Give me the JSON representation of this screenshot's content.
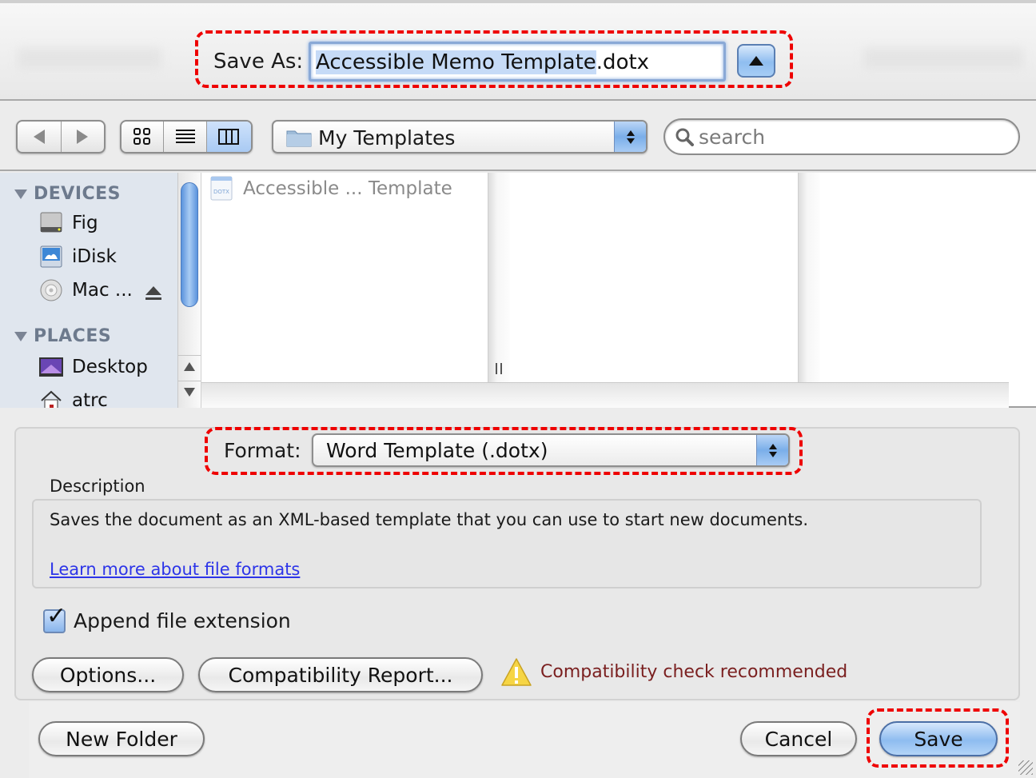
{
  "save_as": {
    "label": "Save As:",
    "filename_selected": "Accessible Memo Template",
    "filename_extension": ".dotx",
    "expand_button_icon": "triangle-up-icon"
  },
  "toolbar": {
    "back_icon": "back-arrow-icon",
    "forward_icon": "forward-arrow-icon",
    "view_modes": [
      {
        "name": "icon-view",
        "icon": "grid-icon",
        "active": false
      },
      {
        "name": "list-view",
        "icon": "list-icon",
        "active": false
      },
      {
        "name": "column-view",
        "icon": "columns-icon",
        "active": true
      }
    ],
    "location": "My Templates",
    "search_placeholder": "search"
  },
  "sidebar": {
    "sections": [
      {
        "title": "DEVICES",
        "items": [
          {
            "label": "Fig",
            "icon": "hard-drive-icon"
          },
          {
            "label": "iDisk",
            "icon": "idisk-icon"
          },
          {
            "label": "Mac ...",
            "icon": "cd-disc-icon",
            "ejectable": true
          }
        ]
      },
      {
        "title": "PLACES",
        "items": [
          {
            "label": "Desktop",
            "icon": "desktop-icon"
          },
          {
            "label": "atrc",
            "icon": "home-icon"
          }
        ]
      }
    ]
  },
  "browser": {
    "files": [
      {
        "name": "Accessible ... Template",
        "icon": "dotx-file-icon",
        "icon_label": "DOTX",
        "dimmed": true
      }
    ]
  },
  "format": {
    "label": "Format:",
    "selected": "Word Template (.dotx)"
  },
  "description": {
    "label": "Description",
    "text": "Saves the document as an XML-based template that you can use to start new documents.",
    "link": "Learn more about file formats"
  },
  "append_extension": {
    "label": "Append file extension",
    "checked": true
  },
  "buttons": {
    "options": "Options...",
    "compatibility_report": "Compatibility Report...",
    "new_folder": "New Folder",
    "cancel": "Cancel",
    "save": "Save"
  },
  "compatibility_warning": "Compatibility check recommended",
  "colors": {
    "highlight_dash": "#ee0000",
    "selection": "#c6dbf7",
    "link": "#2d35e8",
    "warning_text": "#7a1f1f"
  }
}
